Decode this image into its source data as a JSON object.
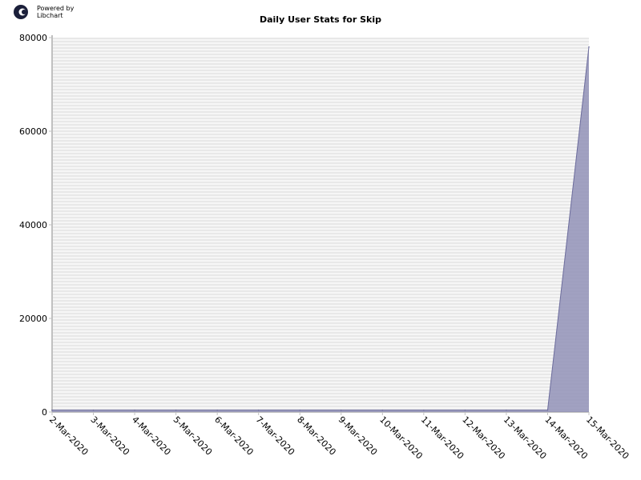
{
  "branding": {
    "line1": "Powered by",
    "line2": "Libchart"
  },
  "chart_data": {
    "type": "area",
    "title": "Daily User Stats for Skip",
    "xlabel": "",
    "ylabel": "",
    "categories": [
      "2-Mar-2020",
      "3-Mar-2020",
      "4-Mar-2020",
      "5-Mar-2020",
      "6-Mar-2020",
      "7-Mar-2020",
      "8-Mar-2020",
      "9-Mar-2020",
      "10-Mar-2020",
      "11-Mar-2020",
      "12-Mar-2020",
      "13-Mar-2020",
      "14-Mar-2020",
      "15-Mar-2020"
    ],
    "values": [
      400,
      400,
      400,
      400,
      400,
      400,
      400,
      400,
      400,
      400,
      400,
      400,
      400,
      78000
    ],
    "ylim": [
      0,
      80000
    ],
    "yticks": [
      0,
      20000,
      40000,
      60000,
      80000
    ],
    "grid": true,
    "colors": {
      "line": "#6c6c9c",
      "fill": "#8c8cb4",
      "grid_a": "#e8e8e8",
      "grid_b": "#f6f6f6",
      "axis": "#c0c0c0"
    }
  }
}
